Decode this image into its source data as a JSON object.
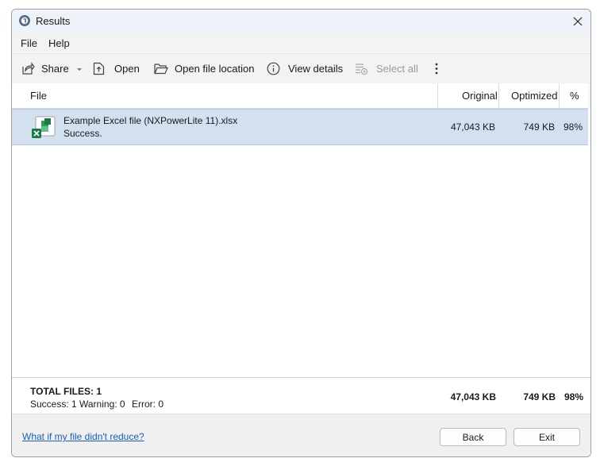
{
  "window": {
    "title": "Results"
  },
  "menu": {
    "file": "File",
    "help": "Help"
  },
  "toolbar": {
    "share": "Share",
    "open": "Open",
    "open_location": "Open file location",
    "view_details": "View details",
    "select_all": "Select all"
  },
  "table": {
    "headers": {
      "file": "File",
      "original": "Original",
      "optimized": "Optimized",
      "percent": "%"
    },
    "rows": [
      {
        "name": "Example Excel file (NXPowerLite 11).xlsx",
        "status": "Success.",
        "original": "47,043 KB",
        "optimized": "749 KB",
        "percent": "98%"
      }
    ]
  },
  "totals": {
    "title": "TOTAL FILES: 1",
    "success": "Success: 1",
    "warning": "Warning: 0",
    "error": "Error: 0",
    "original": "47,043 KB",
    "optimized": "749 KB",
    "percent": "98%"
  },
  "footer": {
    "help_link": "What if my file didn't reduce?",
    "back": "Back",
    "exit": "Exit"
  },
  "colors": {
    "selection": "#d3e0f0",
    "link": "#1a5fb4",
    "excel_green": "#1d7a45"
  }
}
